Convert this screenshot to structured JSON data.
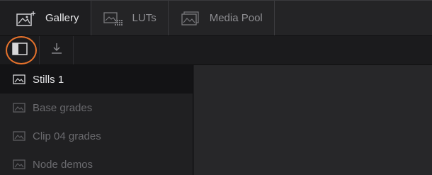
{
  "tabs": [
    {
      "label": "Gallery",
      "icon": "gallery-icon",
      "active": true
    },
    {
      "label": "LUTs",
      "icon": "luts-icon",
      "active": false
    },
    {
      "label": "Media Pool",
      "icon": "media-pool-icon",
      "active": false
    }
  ],
  "toolbar": {
    "sidebar_toggle_icon": "sidebar-toggle-icon",
    "import_icon": "import-icon",
    "highlight_color": "#e8732c"
  },
  "albums": [
    {
      "label": "Stills 1",
      "selected": true
    },
    {
      "label": "Base grades",
      "selected": false
    },
    {
      "label": "Clip 04 grades",
      "selected": false
    },
    {
      "label": "Node demos",
      "selected": false
    }
  ]
}
